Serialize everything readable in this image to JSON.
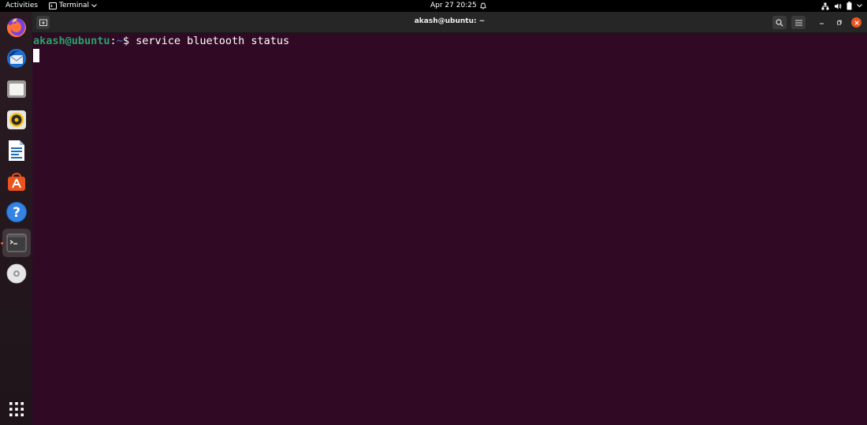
{
  "topbar": {
    "activities": "Activities",
    "app_name": "Terminal",
    "clock": "Apr 27  20:25"
  },
  "dock": {
    "items": [
      {
        "name": "Firefox",
        "icon": "firefox-icon"
      },
      {
        "name": "Thunderbird Mail",
        "icon": "thunderbird-icon"
      },
      {
        "name": "Files",
        "icon": "files-icon"
      },
      {
        "name": "Rhythmbox",
        "icon": "rhythmbox-icon"
      },
      {
        "name": "LibreOffice Writer",
        "icon": "libreoffice-writer-icon"
      },
      {
        "name": "Ubuntu Software",
        "icon": "ubuntu-software-icon"
      },
      {
        "name": "Help",
        "icon": "help-icon"
      },
      {
        "name": "Terminal",
        "icon": "terminal-icon"
      },
      {
        "name": "DVD",
        "icon": "disc-icon"
      }
    ],
    "apps_grid": "show-applications-icon"
  },
  "window": {
    "title": "akash@ubuntu: ~",
    "colors": {
      "background": "#300a24",
      "user": "#26a269",
      "path": "#3465a4",
      "accent": "#e95420"
    }
  },
  "terminal": {
    "user_host": "akash@ubuntu",
    "separator": ":",
    "path": "~",
    "prompt_symbol": "$ ",
    "command": "service bluetooth status"
  }
}
